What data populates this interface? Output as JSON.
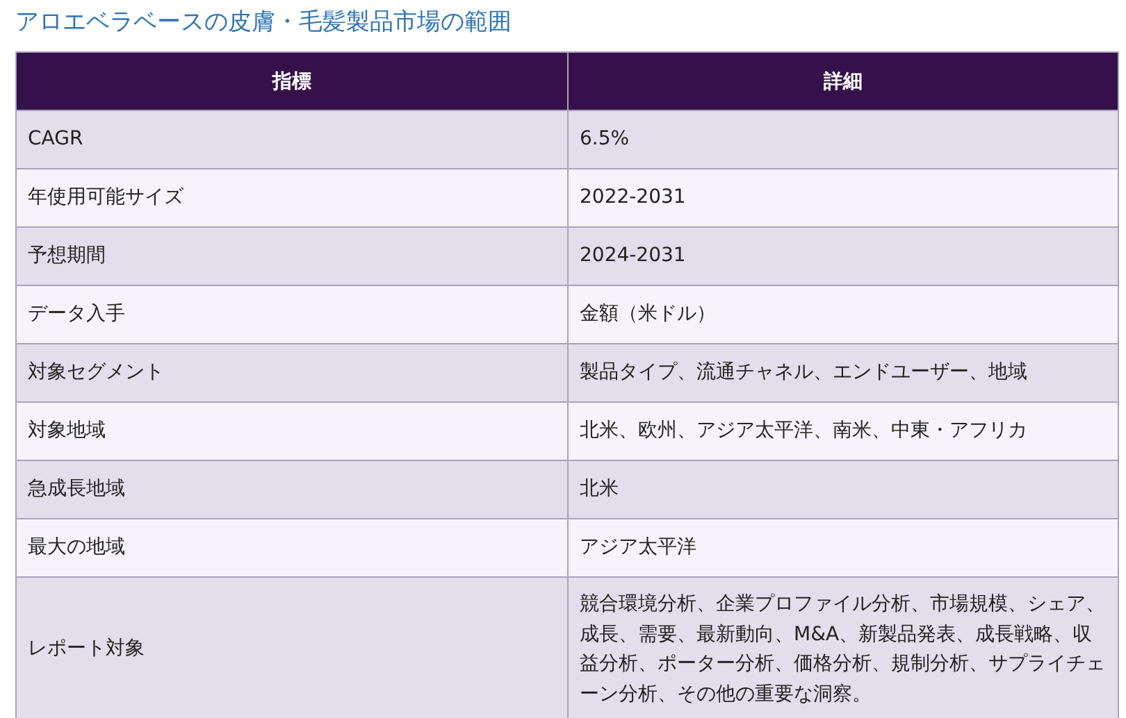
{
  "title": "アロエベラベースの皮膚・毛髪製品市場の範囲",
  "table": {
    "columns": [
      "指標",
      "詳細"
    ],
    "rows": [
      [
        "CAGR",
        "6.5%"
      ],
      [
        "年使用可能サイズ",
        "2022-2031"
      ],
      [
        "予想期間",
        "2024-2031"
      ],
      [
        "データ入手",
        "金額（米ドル）"
      ],
      [
        "対象セグメント",
        "製品タイプ、流通チャネル、エンドユーザー、地域"
      ],
      [
        "対象地域",
        "北米、欧州、アジア太平洋、南米、中東・アフリカ"
      ],
      [
        "急成長地域",
        "北米"
      ],
      [
        "最大の地域",
        "アジア太平洋"
      ],
      [
        "レポート対象",
        "競合環境分析、企業プロファイル分析、市場規模、シェア、成長、需要、最新動向、M&A、新製品発表、成長戦略、収益分析、ポーター分析、価格分析、規制分析、サプライチェーン分析、その他の重要な洞察。"
      ]
    ]
  }
}
